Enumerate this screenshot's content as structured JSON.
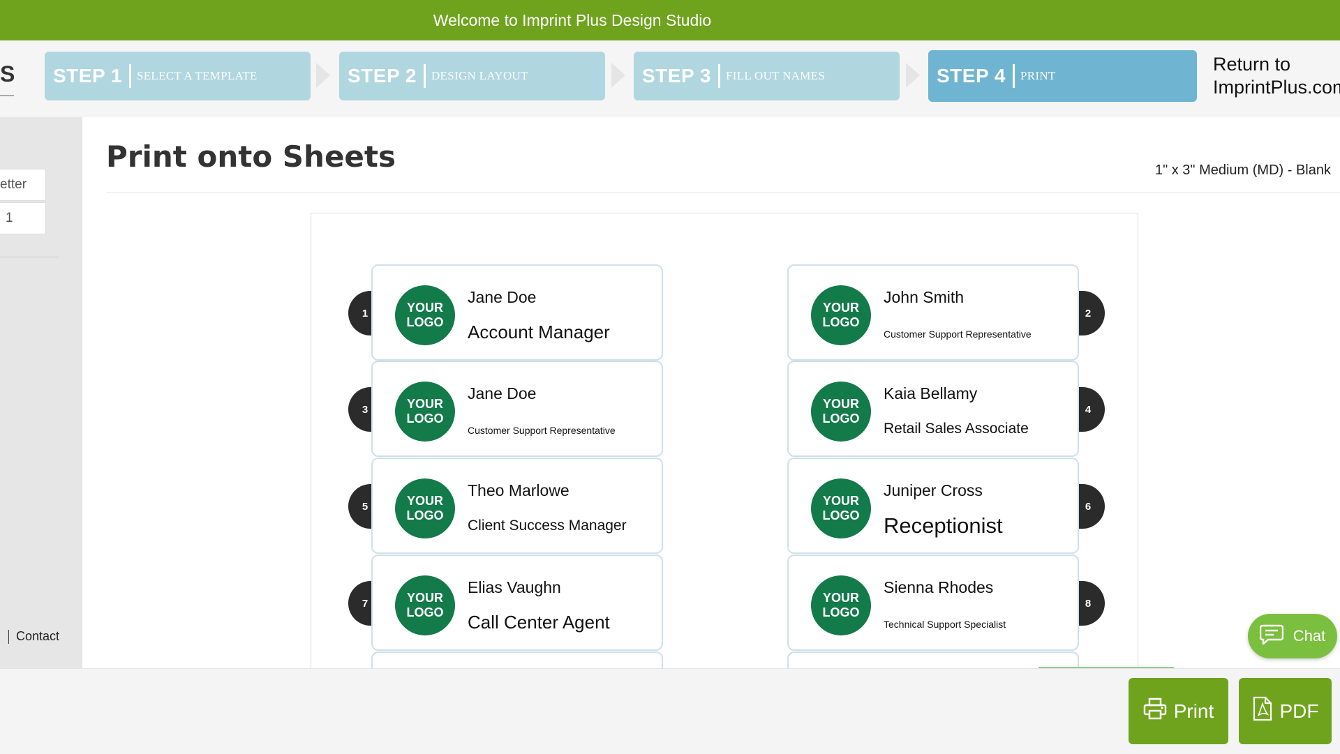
{
  "header": {
    "title": "Welcome to Imprint Plus Design Studio"
  },
  "steps": [
    {
      "num": "STEP 1",
      "label": "SELECT A TEMPLATE",
      "active": false
    },
    {
      "num": "STEP 2",
      "label": "DESIGN LAYOUT",
      "active": false
    },
    {
      "num": "STEP 3",
      "label": "FILL OUT NAMES",
      "active": false
    },
    {
      "num": "STEP 4",
      "label": "PRINT",
      "active": true
    }
  ],
  "return_link": "Return to\nImprintPlus.com",
  "left_fragment": "S",
  "sidebar": {
    "paper_size": "etter",
    "copies": "1",
    "contact": "Contact"
  },
  "main": {
    "title": "Print onto Sheets",
    "template_name": "1\" x 3\" Medium (MD) - Blank"
  },
  "logo_text": [
    "YOUR",
    "LOGO"
  ],
  "labels": [
    {
      "num": "1",
      "name": "Jane Doe",
      "role": "Account Manager",
      "role_size": "big"
    },
    {
      "num": "2",
      "name": "John Smith",
      "role": "Customer Support Representative",
      "role_size": "small"
    },
    {
      "num": "3",
      "name": "Jane Doe",
      "role": "Customer Support Representative",
      "role_size": "small"
    },
    {
      "num": "4",
      "name": "Kaia Bellamy",
      "role": "Retail Sales Associate",
      "role_size": "med"
    },
    {
      "num": "5",
      "name": "Theo Marlowe",
      "role": "Client Success Manager",
      "role_size": "med"
    },
    {
      "num": "6",
      "name": "Juniper Cross",
      "role": "Receptionist",
      "role_size": "xl"
    },
    {
      "num": "7",
      "name": "Elias Vaughn",
      "role": "Call Center Agent",
      "role_size": "big"
    },
    {
      "num": "8",
      "name": "Sienna Rhodes",
      "role": "Technical Support Specialist",
      "role_size": "small"
    }
  ],
  "actions": {
    "print": "Print",
    "pdf": "PDF",
    "chat": "Chat"
  },
  "colors": {
    "brand_green": "#6fa31e",
    "logo_green": "#137a4a",
    "step_inactive": "#b0d6e0",
    "step_active": "#6fb5d1"
  },
  "icons": {
    "print": "printer-icon",
    "pdf": "pdf-file-icon",
    "chat": "chat-bubble-icon"
  }
}
